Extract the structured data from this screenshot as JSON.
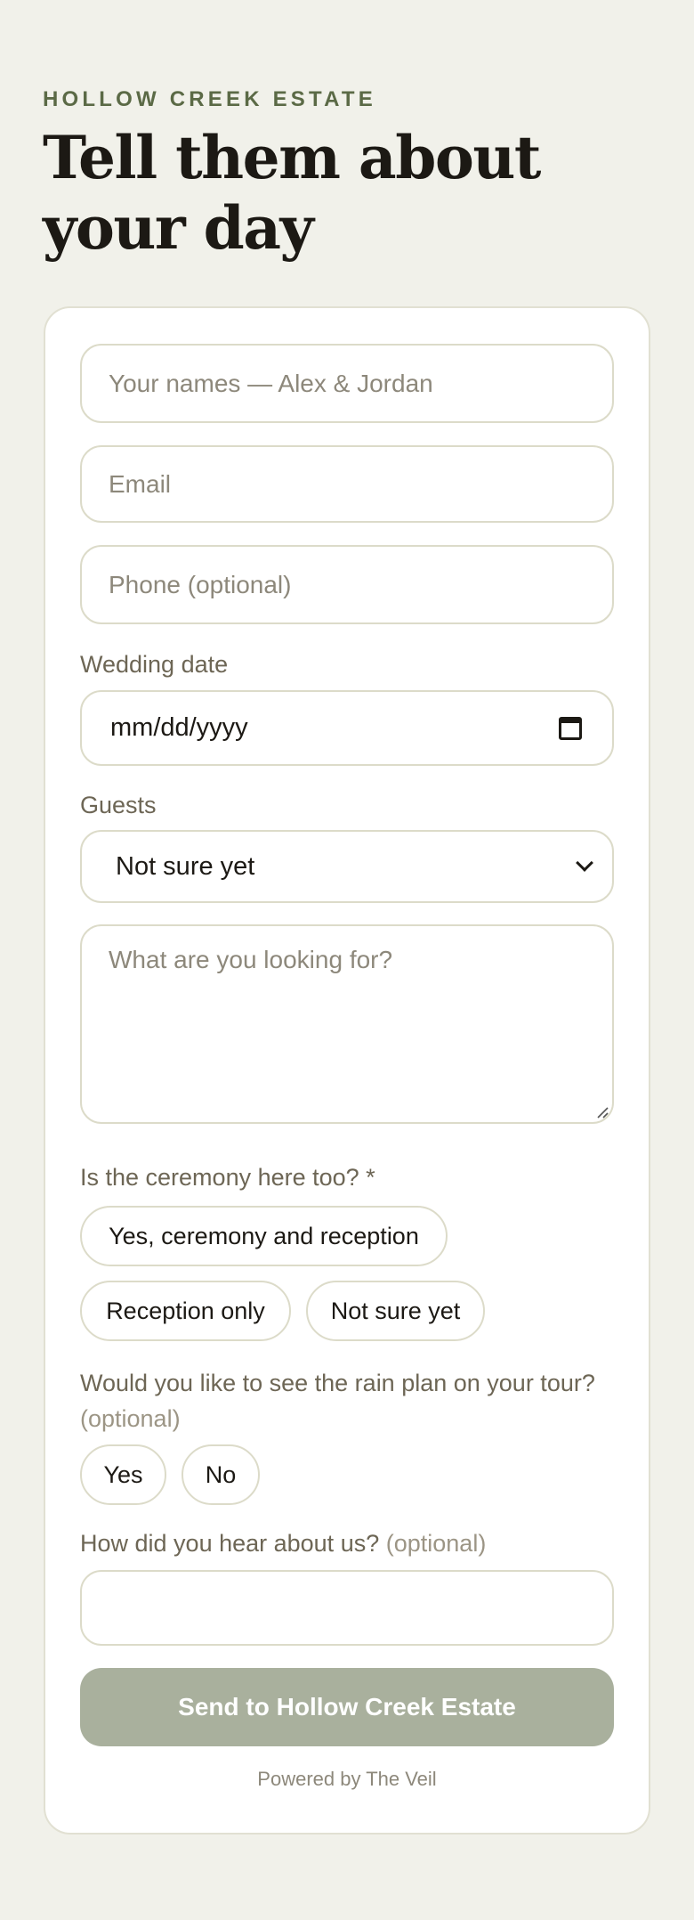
{
  "header": {
    "eyebrow": "HOLLOW CREEK ESTATE",
    "title": "Tell them about your day"
  },
  "form": {
    "names_placeholder": "Your names — Alex & Jordan",
    "email_placeholder": "Email",
    "phone_placeholder": "Phone (optional)",
    "wedding_date_label": "Wedding date",
    "wedding_date_value": "mm/dd/yyyy",
    "guests_label": "Guests",
    "guests_selected": "Not sure yet",
    "message_placeholder": "What are you looking for?",
    "ceremony_question": "Is the ceremony here too? *",
    "ceremony_options": [
      "Yes, ceremony and reception",
      "Reception only",
      "Not sure yet"
    ],
    "rain_question": "Would you like to see the rain plan on your tour?",
    "rain_optional": "(optional)",
    "rain_options": [
      "Yes",
      "No"
    ],
    "hear_question": "How did you hear about us?",
    "hear_optional": "(optional)",
    "hear_value": "",
    "submit_label": "Send to Hollow Creek Estate",
    "powered_by": "Powered by The Veil"
  },
  "colors": {
    "background": "#f1f1ea",
    "accent_green": "#5b6a46",
    "submit_disabled": "#a9b09d",
    "border": "#dcdbc9"
  },
  "icons": {
    "date": "calendar-icon",
    "select": "chevron-down-icon",
    "textarea": "resize-handle-icon"
  }
}
